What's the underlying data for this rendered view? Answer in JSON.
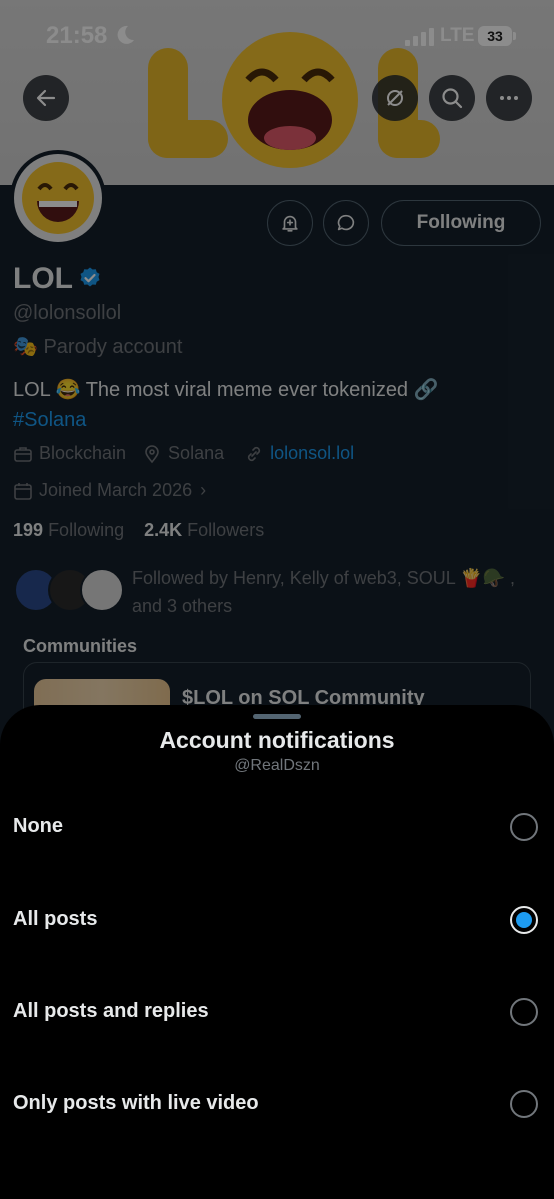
{
  "status_bar": {
    "time": "21:58",
    "network": "LTE",
    "battery": "33"
  },
  "profile": {
    "name": "LOL",
    "handle": "@lolonsollol",
    "parody_label": "Parody account",
    "bio_text": "LOL 😂 The most viral meme ever tokenized 🔗",
    "bio_hashtag": "#Solana",
    "category": "Blockchain",
    "location": "Solana",
    "website": "lolonsol.lol",
    "joined": "Joined March 2026",
    "following_count": "199",
    "following_label": "Following",
    "followers_count": "2.4K",
    "followers_label": "Followers",
    "followed_by": "Followed by Henry, Kelly of web3, SOUL 🍟🪖 , and 3 others",
    "communities_label": "Communities",
    "community_name": "$LOL on SOL Community",
    "following_button": "Following"
  },
  "sheet": {
    "title": "Account notifications",
    "subtitle": "@RealDszn",
    "options": [
      {
        "label": "None",
        "selected": false
      },
      {
        "label": "All posts",
        "selected": true
      },
      {
        "label": "All posts and replies",
        "selected": false
      },
      {
        "label": "Only posts with live video",
        "selected": false
      }
    ]
  },
  "colors": {
    "accent": "#1d9bf0",
    "sheet_bg": "#000000",
    "profile_bg": "#15202b"
  },
  "icons": [
    "back-arrow-icon",
    "hide-icon",
    "search-icon",
    "more-icon",
    "bell-plus-icon",
    "message-icon",
    "verified-badge-icon",
    "mask-icon",
    "briefcase-icon",
    "location-pin-icon",
    "link-icon",
    "calendar-icon",
    "chevron-right-icon"
  ]
}
